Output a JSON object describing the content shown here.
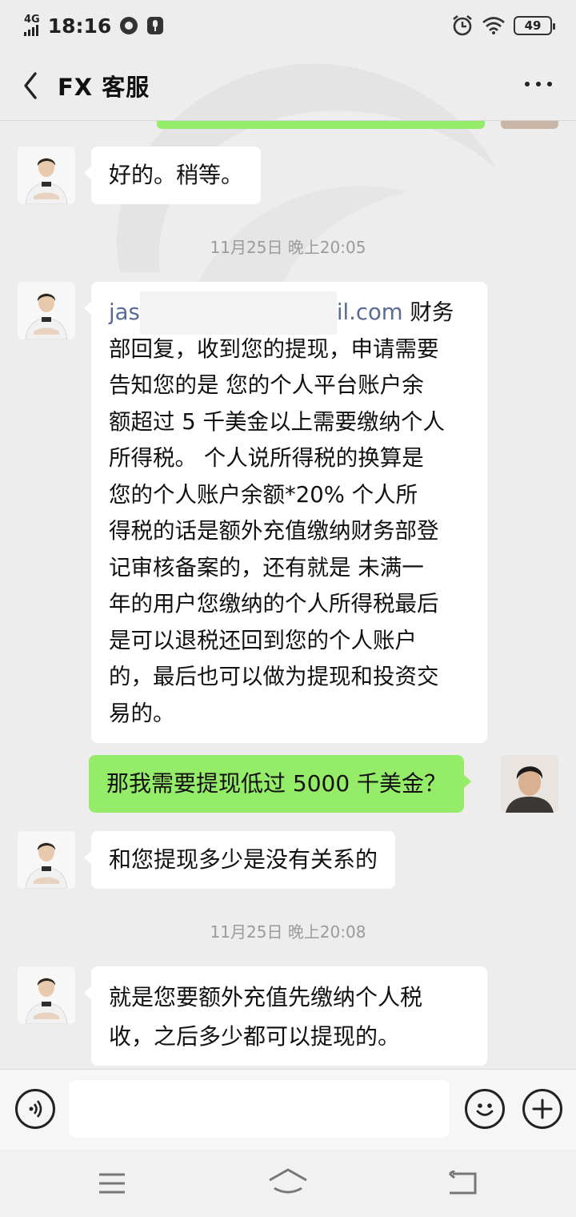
{
  "status_bar": {
    "network": "4G",
    "time": "18:16",
    "battery": "49"
  },
  "header": {
    "title": "FX 客服"
  },
  "messages": [
    {
      "side": "left",
      "text": "好的。稍等。"
    },
    {
      "type": "time",
      "text": "11月25日 晚上20:05"
    },
    {
      "side": "left",
      "email_start": "jas",
      "email_end": "il.com",
      "line1_rest": " 财务",
      "lines": [
        "部回复，收到您的提现，申请需要",
        "告知您的是  您的个人平台账户余",
        "额超过 5 千美金以上需要缴纳个人",
        "所得税。  个人说所得税的换算是",
        "您的个人账户余额*20%    个人所",
        "得税的话是额外充值缴纳财务部登",
        "记审核备案的，还有就是 未满一",
        "年的用户您缴纳的个人所得税最后",
        "是可以退税还回到您的个人账户",
        "的，最后也可以做为提现和投资交",
        "易的。"
      ]
    },
    {
      "side": "right",
      "text": "那我需要提现低过 5000 千美金？"
    },
    {
      "side": "left",
      "text": "和您提现多少是没有关系的"
    },
    {
      "type": "time",
      "text": "11月25日 晚上20:08"
    },
    {
      "side": "left",
      "lines": [
        "就是您要额外充值先缴纳个人税",
        "收，之后多少都可以提现的。"
      ]
    }
  ],
  "input_bar": {
    "placeholder": ""
  },
  "icons": {
    "back": "chevron-left-icon",
    "more": "more-dots-icon",
    "voice": "voice-icon",
    "emoji": "emoji-icon",
    "add": "plus-icon",
    "menu": "menu-icon",
    "home": "home-icon",
    "return": "back-nav-icon"
  },
  "colors": {
    "sent_bubble": "#95ec69",
    "received_bubble": "#ffffff",
    "background": "#ededed",
    "link": "#576b95"
  }
}
